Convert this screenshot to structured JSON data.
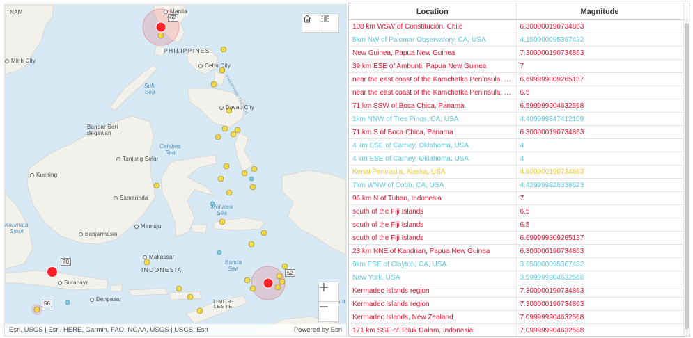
{
  "map": {
    "attribution": "Esri, USGS | Esri, HERE, Garmin, FAO, NOAA, USGS | USGS, Esri",
    "powered_by": "Powered by Esri",
    "labels": {
      "tnam": "TNAM",
      "manila": "Manila",
      "philippines": "PHILIPPINES",
      "minh_city": "Minh City",
      "cebu_city": "Cebu City",
      "philippine_trench": "PHILIPPINE TRENCH",
      "sulu_sea": "Sulu\nSea",
      "davao_city": "Davao City",
      "bandar_seri_begawan": "Bandar Seri\nBegawan",
      "celebes_sea": "Celebes\nSea",
      "kuching": "Kuching",
      "tanjung_selor": "Tanjung Selor",
      "samarinda": "Samarinda",
      "molucca_sea": "Molucca\nSea",
      "karimata_strait": "Karimata\nStrait",
      "mamuju": "Mamuju",
      "banjarmasin": "Banjarmasin",
      "makassar": "Makassar",
      "indonesia": "INDONESIA",
      "banda_sea": "Banda\nSea",
      "surabaya": "Surabaya",
      "denpasar": "Denpasar",
      "timor_leste": "TIMOR-\nLESTE",
      "ara": "Ara"
    },
    "clusters": {
      "c62": "62",
      "c70": "70",
      "c56": "56",
      "c52": "52"
    },
    "colors": {
      "water": "#d6e9f4",
      "land": "#f3f1ec",
      "quake_high": "#ff1f27",
      "quake_mid": "#f2d94c",
      "quake_low": "#7dd3e6"
    },
    "icons": {
      "home": "home-icon",
      "layers": "layer-list-icon",
      "zoom_in": "plus-icon",
      "zoom_out": "minus-icon"
    }
  },
  "table": {
    "columns": [
      "Location",
      "Magnitude"
    ],
    "rows": [
      {
        "location": "108 km WSW of Constitución, Chile",
        "magnitude": "6.300000190734863",
        "color": "#e8112d"
      },
      {
        "location": "5km NW of Palomar Observatory, CA, USA",
        "magnitude": "4.150000095367432",
        "color": "#5bc8dd"
      },
      {
        "location": "New Guinea, Papua New Guinea",
        "magnitude": "7.300000190734863",
        "color": "#e8112d"
      },
      {
        "location": "39 km ESE of Ambunti, Papua New Guinea",
        "magnitude": "7",
        "color": "#e8112d"
      },
      {
        "location": "near the east coast of the Kamchatka Peninsula, Rus...",
        "magnitude": "6.699999809265137",
        "color": "#e8112d"
      },
      {
        "location": "near the east coast of the Kamchatka Peninsula, Rus...",
        "magnitude": "6.5",
        "color": "#e8112d"
      },
      {
        "location": "71 km SSW of Boca Chica, Panama",
        "magnitude": "6.599999904632568",
        "color": "#e8112d"
      },
      {
        "location": "1km NNW of Tres Pinos, CA, USA",
        "magnitude": "4.409999847412109",
        "color": "#5bc8dd"
      },
      {
        "location": "71 km S of Boca Chica, Panama",
        "magnitude": "6.300000190734863",
        "color": "#e8112d"
      },
      {
        "location": "4 km ESE of Carney, Oklahoma, USA",
        "magnitude": "4",
        "color": "#5bc8dd"
      },
      {
        "location": "4 km ESE of Carney, Oklahoma, USA",
        "magnitude": "4",
        "color": "#5bc8dd"
      },
      {
        "location": "Kenai Peninsula, Alaska, USA",
        "magnitude": "4.800000190734863",
        "color": "#ecc92a"
      },
      {
        "location": "7km WNW of Cobb, CA, USA",
        "magnitude": "4.429999828338623",
        "color": "#5bc8dd"
      },
      {
        "location": "96 km N of Tuban, Indonesia",
        "magnitude": "7",
        "color": "#e8112d"
      },
      {
        "location": "south of the Fiji Islands",
        "magnitude": "6.5",
        "color": "#e8112d"
      },
      {
        "location": "south of the Fiji Islands",
        "magnitude": "6.5",
        "color": "#e8112d"
      },
      {
        "location": "south of the Fiji Islands",
        "magnitude": "6.699999809265137",
        "color": "#e8112d"
      },
      {
        "location": "23 km NNE of Kandrian, Papua New Guinea",
        "magnitude": "6.300000190734863",
        "color": "#e8112d"
      },
      {
        "location": "9km ESE of Clayton, CA, USA",
        "magnitude": "3.650000095367432",
        "color": "#5bc8dd"
      },
      {
        "location": "New York, USA",
        "magnitude": "3.599999904632568",
        "color": "#5bc8dd"
      },
      {
        "location": "Kermadec Islands region",
        "magnitude": "7.300000190734863",
        "color": "#e8112d"
      },
      {
        "location": "Kermadec Islands region",
        "magnitude": "7.300000190734863",
        "color": "#e8112d"
      },
      {
        "location": "Kermadec Islands, New Zealand",
        "magnitude": "7.099999904632568",
        "color": "#e8112d"
      },
      {
        "location": "171 km SSE of Teluk Dalam, Indonesia",
        "magnitude": "7.099999904632568",
        "color": "#e8112d"
      }
    ]
  }
}
